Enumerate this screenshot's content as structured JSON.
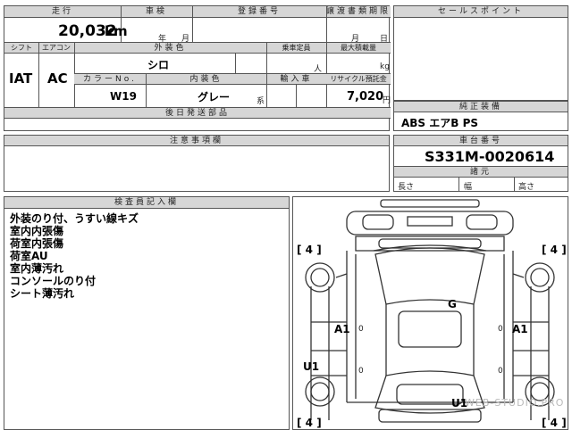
{
  "sheet": {
    "col_distance": "走行",
    "col_inspection": "車検",
    "col_registration": "登録番号",
    "col_transfer_deadline": "譲渡書類期限",
    "col_sales_point": "セールスポイント",
    "distance_value": "20,032",
    "distance_unit": "km",
    "inspection_year": "年",
    "inspection_month": "月",
    "transfer_month": "月",
    "transfer_day": "日",
    "col_shift": "シフト",
    "col_aircon": "エアコン",
    "col_exterior_color": "外装色",
    "col_capacity": "乗車定員",
    "col_max_load": "最大積載量",
    "shift_value": "IAT",
    "aircon_value": "AC",
    "exterior_color_value": "シロ",
    "capacity_unit": "人",
    "load_unit": "kg",
    "col_color_no": "カラーNo.",
    "col_interior_color": "内装色",
    "col_import": "輸入車",
    "col_recycle": "リサイクル預託金",
    "color_no_value": "W19",
    "interior_color_value": "グレー",
    "interior_color_suffix": "系",
    "recycle_value": "7,020",
    "recycle_unit": "円",
    "col_later_parts": "後日発送部品",
    "col_genuine_equipment": "純正装備",
    "genuine_equipment_value": "ABS エアB PS",
    "col_notes": "注意事項欄",
    "col_chassis_no": "車台番号",
    "chassis_no_value": "S331M-0020614",
    "col_dimensions": "諸元",
    "dim_length": "長さ",
    "dim_width": "幅",
    "dim_height": "高さ",
    "col_inspector": "検査員記入欄",
    "inspector_notes": [
      "外装のり付、うすい線キズ",
      "室内内張傷",
      "荷室内張傷",
      "荷室AU",
      "室内薄汚れ",
      "コンソールのり付",
      "シート薄汚れ"
    ]
  },
  "diagram": {
    "tire_marks": [
      "[ 4 ]",
      "[ 4 ]",
      "[ 4 ]",
      "[ 4 ]"
    ],
    "damage_marks": [
      "G",
      "A1",
      "A1",
      "U1",
      "U1"
    ],
    "zero_marks": [
      "0",
      "0",
      "0",
      "0"
    ],
    "watermark": "WEB-STUDIO.PRO"
  }
}
